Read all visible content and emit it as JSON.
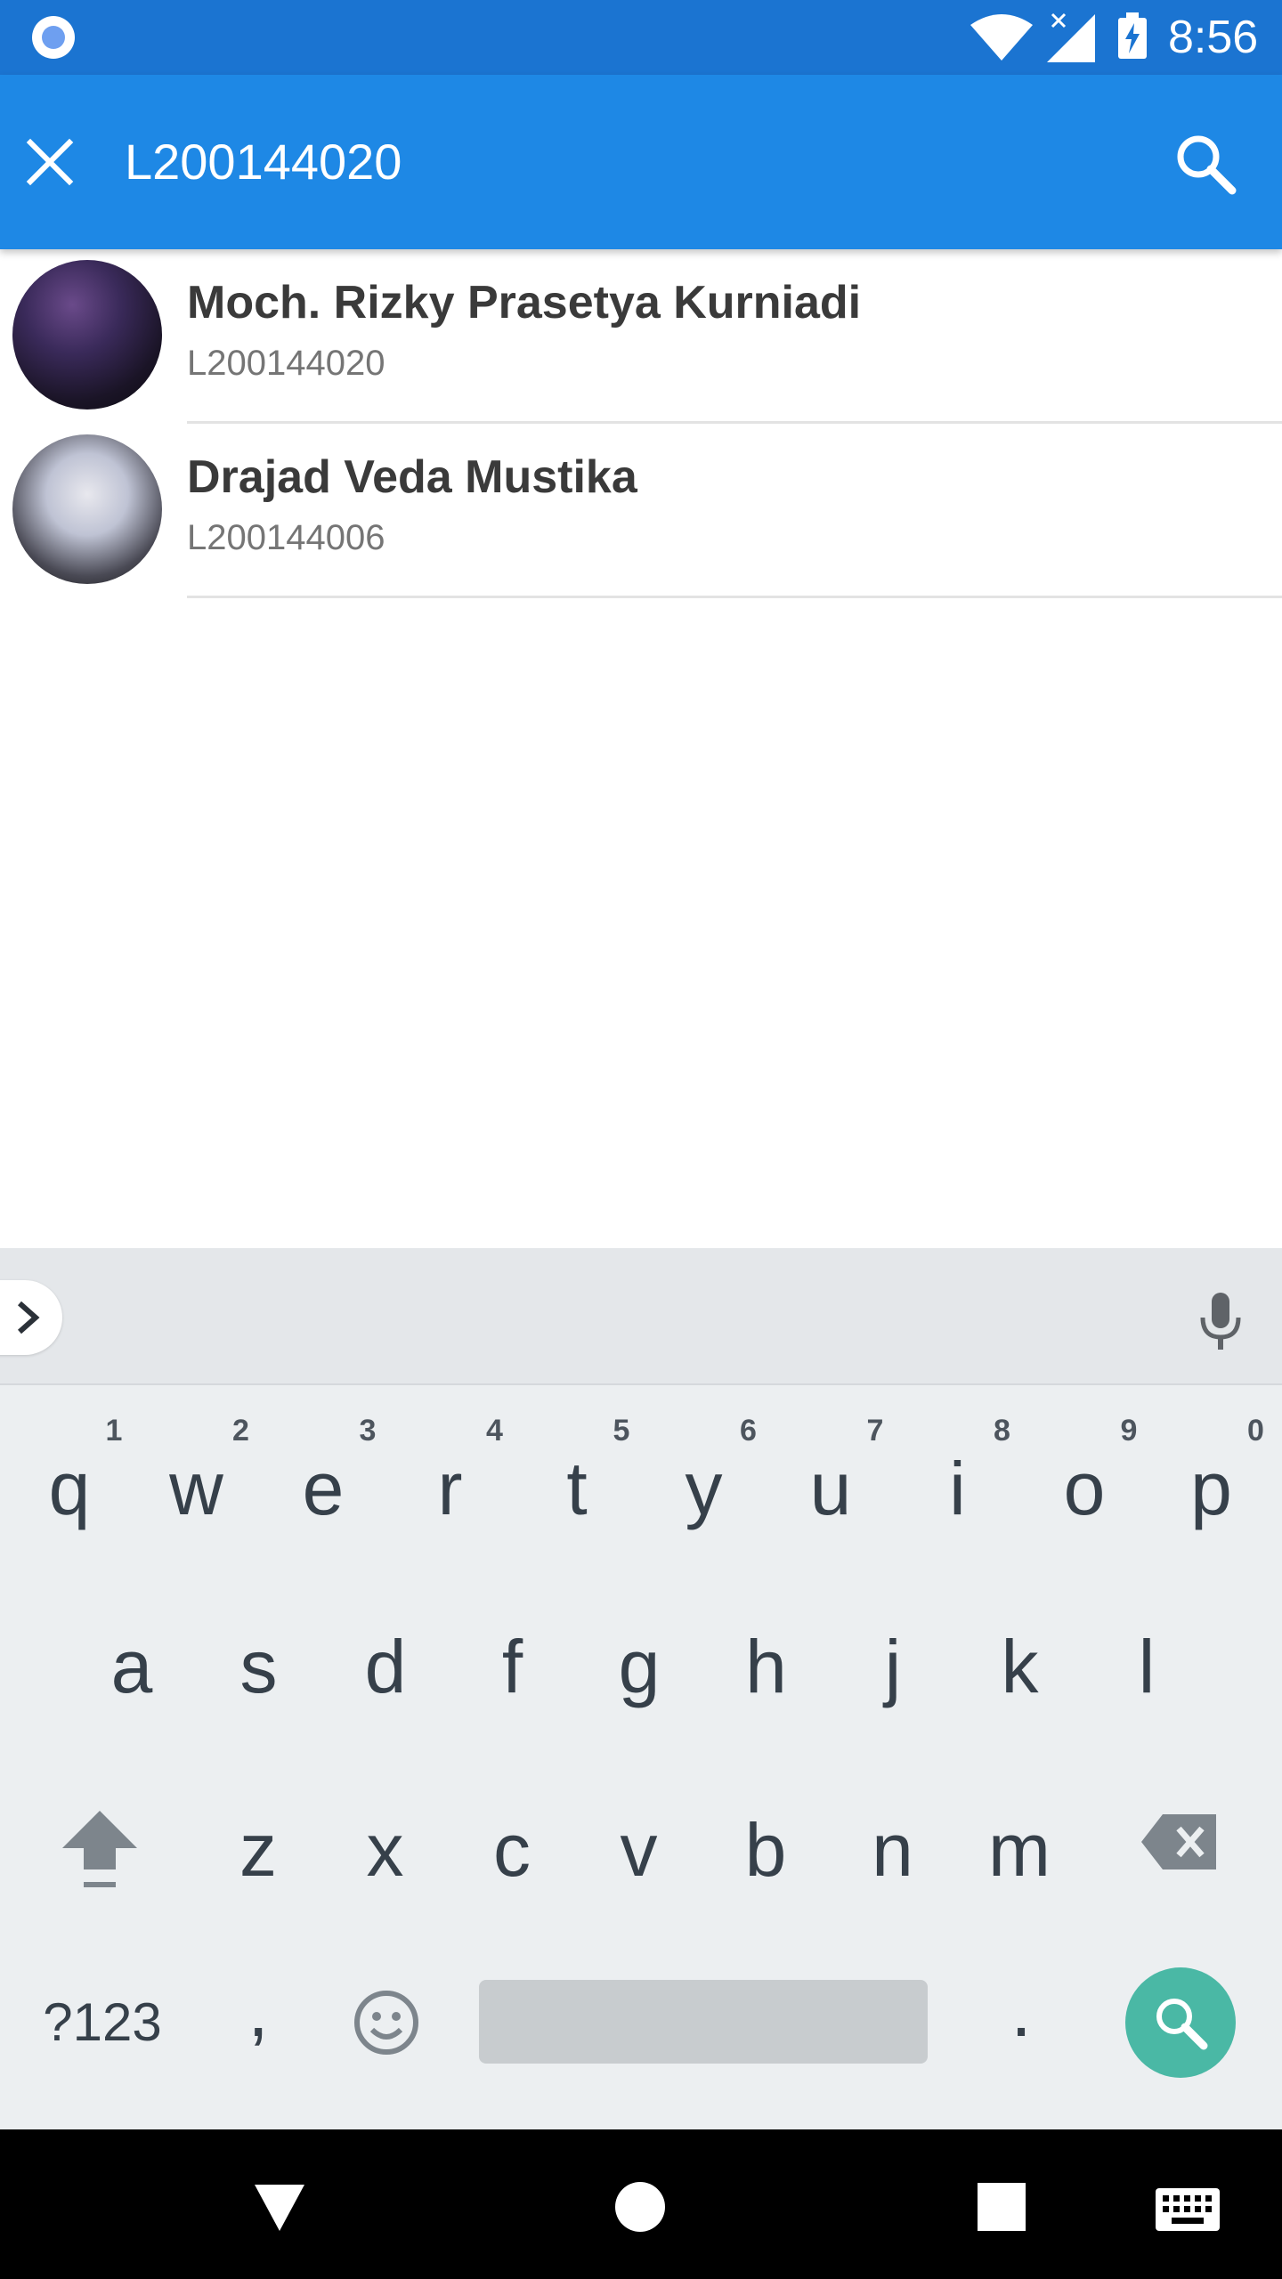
{
  "status_bar": {
    "time": "8:56",
    "icons": [
      "notification-dot-icon",
      "wifi-icon",
      "signal-icon",
      "battery-charging-icon"
    ]
  },
  "toolbar": {
    "close_icon": "close-icon",
    "query": "L200144020",
    "search_icon": "search-icon",
    "background_color": "#1e88e5"
  },
  "results": [
    {
      "name": "Moch. Rizky Prasetya Kurniadi",
      "nim": "L200144020"
    },
    {
      "name": "Drajad Veda Mustika",
      "nim": "L200144006"
    }
  ],
  "keyboard": {
    "row1": [
      "q",
      "w",
      "e",
      "r",
      "t",
      "y",
      "u",
      "i",
      "o",
      "p"
    ],
    "row1_hints": [
      "1",
      "2",
      "3",
      "4",
      "5",
      "6",
      "7",
      "8",
      "9",
      "0"
    ],
    "row2": [
      "a",
      "s",
      "d",
      "f",
      "g",
      "h",
      "j",
      "k",
      "l"
    ],
    "row3": [
      "z",
      "x",
      "c",
      "v",
      "b",
      "n",
      "m"
    ],
    "symbols_label": "?123",
    "comma": ",",
    "period": ".",
    "action_color": "#4ab8a5"
  },
  "nav_bar": {
    "icons": [
      "back-icon",
      "home-icon",
      "recents-icon",
      "keyboard-switch-icon"
    ]
  }
}
